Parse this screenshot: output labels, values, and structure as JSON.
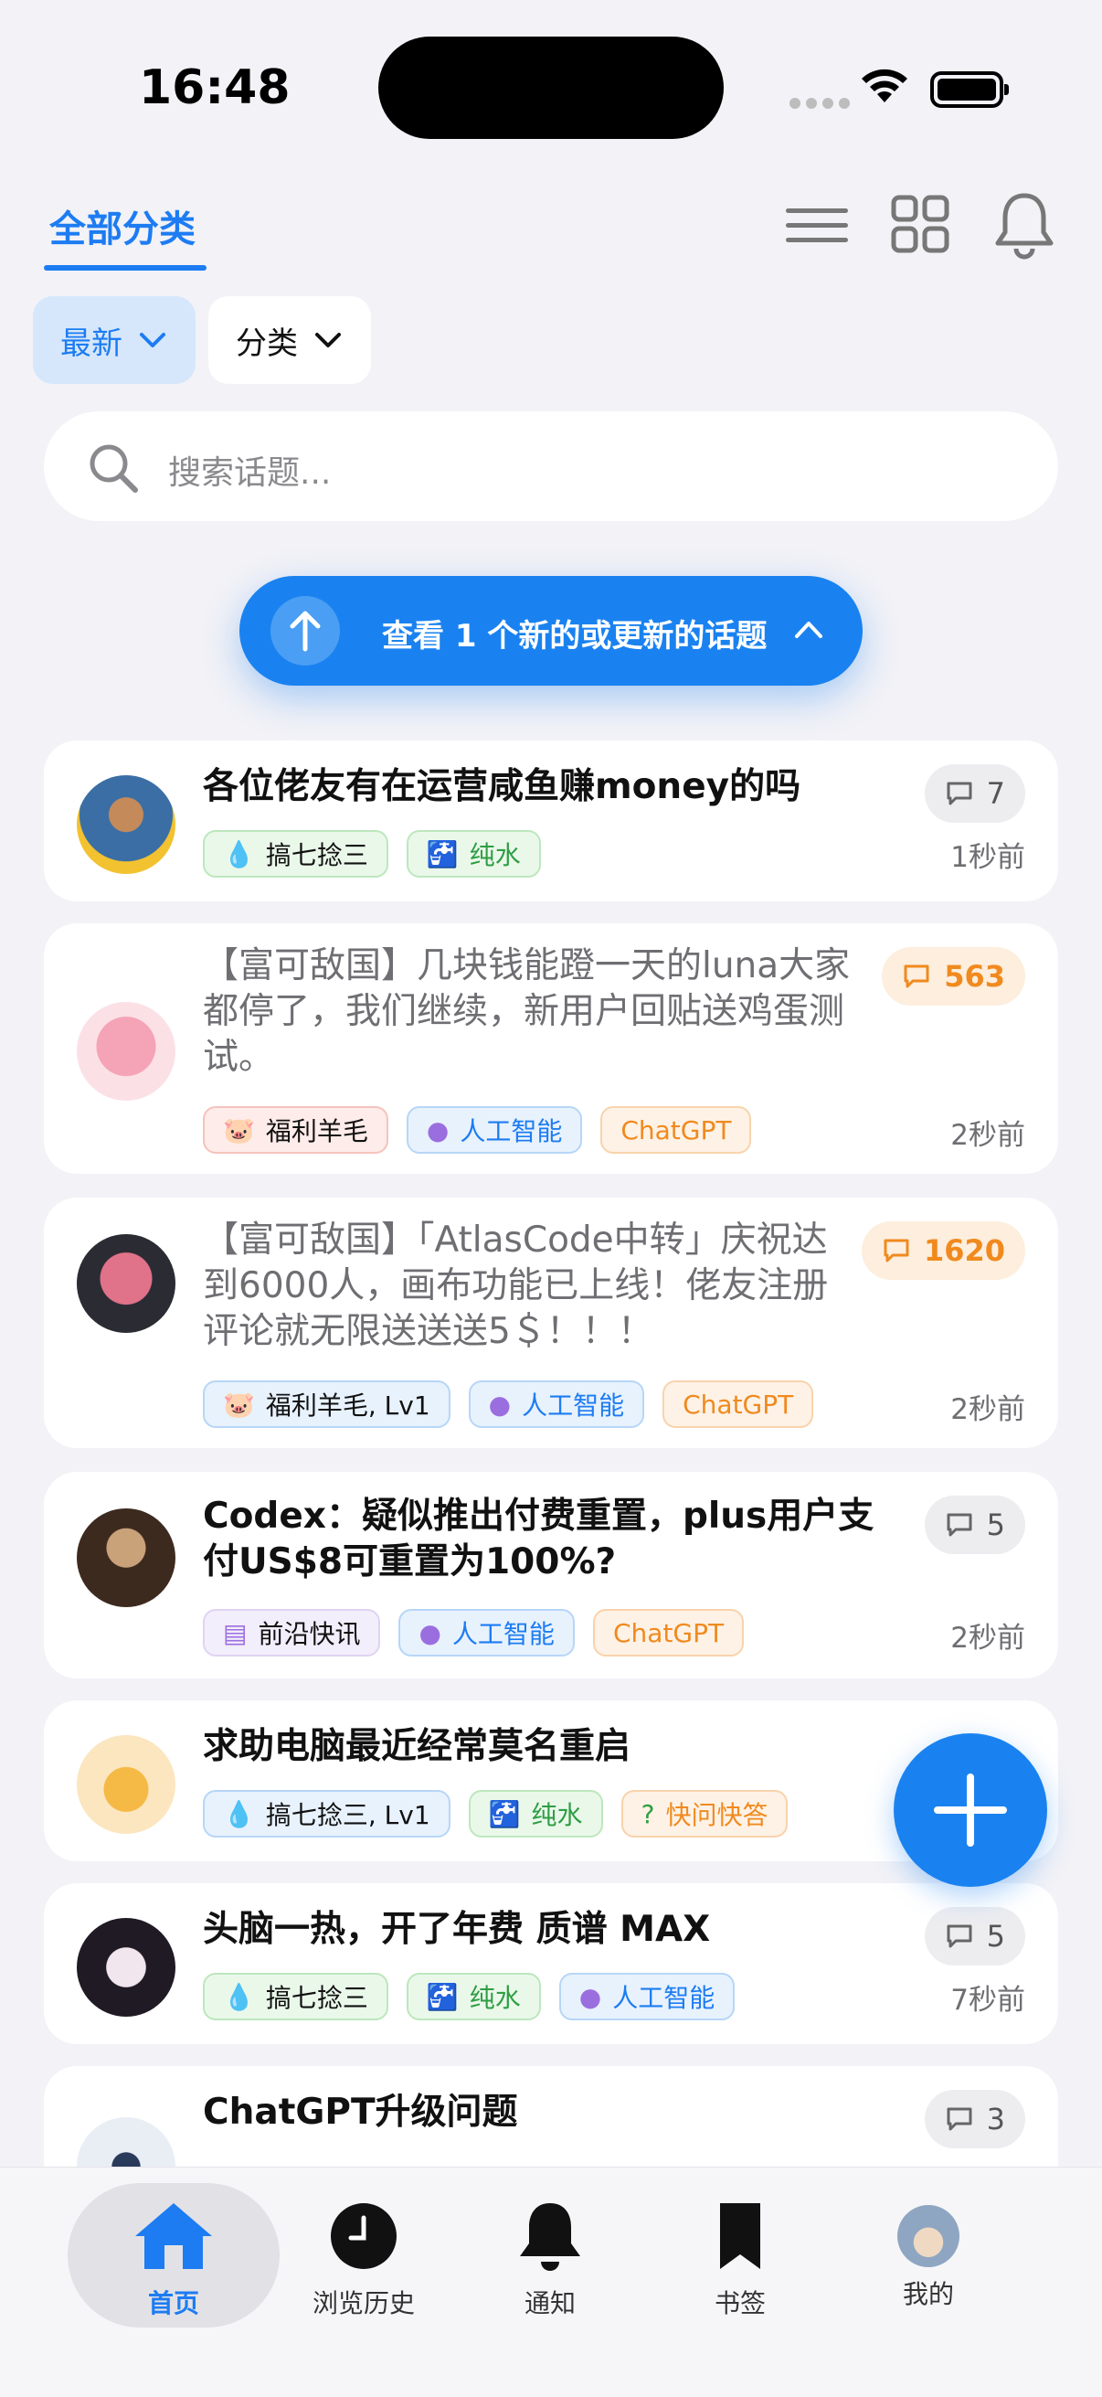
{
  "status_bar": {
    "time": "16:48"
  },
  "header": {
    "tab_label": "全部分类",
    "icons": [
      "menu-icon",
      "grid-icon",
      "bell-icon"
    ]
  },
  "filters": {
    "latest": "最新",
    "category": "分类"
  },
  "search": {
    "placeholder": "搜索话题..."
  },
  "new_topics_button": {
    "label": "查看 1 个新的或更新的话题"
  },
  "colors": {
    "accent": "#1a82f0",
    "hot_count": "#f08a1f",
    "background": "#f2f2f7"
  },
  "topics": [
    {
      "title": "各位佬友有在运营咸鱼赚money的吗",
      "read": false,
      "replies": "7",
      "time_ago": "1秒前",
      "tags": [
        {
          "label": "搞七捻三",
          "icon": "droplet-icon"
        },
        {
          "label": "纯水",
          "icon": "faucet-icon"
        }
      ]
    },
    {
      "title": "【富可敌国】几块钱能蹬一天的luna大家都停了，我们继续，新用户回贴送鸡蛋测试。",
      "read": true,
      "replies": "563",
      "time_ago": "2秒前",
      "tags": [
        {
          "label": "福利羊毛",
          "icon": "piggy-bank-icon"
        },
        {
          "label": "人工智能",
          "icon": "brain-icon"
        },
        {
          "label": "ChatGPT",
          "icon": ""
        }
      ]
    },
    {
      "title": "【富可敌国】「AtlasCode中转」庆祝达到6000人，画布功能已上线！佬友注册评论就无限送送送5＄！！！",
      "read": true,
      "replies": "1620",
      "time_ago": "2秒前",
      "tags": [
        {
          "label": "福利羊毛, Lv1",
          "icon": "piggy-bank-icon"
        },
        {
          "label": "人工智能",
          "icon": "brain-icon"
        },
        {
          "label": "ChatGPT",
          "icon": ""
        }
      ]
    },
    {
      "title": "Codex：疑似推出付费重置，plus用户支付US$8可重置为100%?",
      "read": false,
      "replies": "5",
      "time_ago": "2秒前",
      "tags": [
        {
          "label": "前沿快讯",
          "icon": "newspaper-icon"
        },
        {
          "label": "人工智能",
          "icon": "brain-icon"
        },
        {
          "label": "ChatGPT",
          "icon": ""
        }
      ]
    },
    {
      "title": "求助电脑最近经常莫名重启",
      "read": false,
      "replies": "",
      "time_ago": "",
      "tags": [
        {
          "label": "搞七捻三, Lv1",
          "icon": "droplet-icon"
        },
        {
          "label": "纯水",
          "icon": "faucet-icon"
        },
        {
          "label": "快问快答",
          "icon": "question-icon"
        }
      ]
    },
    {
      "title": "头脑一热，开了年费 质谱 MAX",
      "read": false,
      "replies": "5",
      "time_ago": "7秒前",
      "tags": [
        {
          "label": "搞七捻三",
          "icon": "droplet-icon"
        },
        {
          "label": "纯水",
          "icon": "faucet-icon"
        },
        {
          "label": "人工智能",
          "icon": "brain-icon"
        }
      ]
    },
    {
      "title": "ChatGPT升级问题",
      "read": false,
      "replies": "3",
      "time_ago": "",
      "tags": []
    }
  ],
  "bottom_nav": [
    {
      "label": "首页",
      "icon": "home-icon",
      "active": true
    },
    {
      "label": "浏览历史",
      "icon": "clock-icon",
      "active": false
    },
    {
      "label": "通知",
      "icon": "bell-icon",
      "active": false
    },
    {
      "label": "书签",
      "icon": "bookmark-icon",
      "active": false
    },
    {
      "label": "我的",
      "icon": "avatar",
      "active": false
    }
  ]
}
